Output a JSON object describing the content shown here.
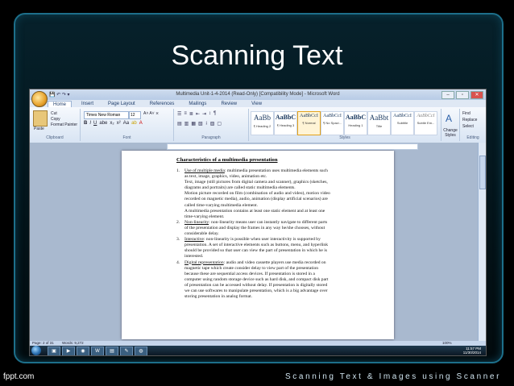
{
  "slide": {
    "title": "Scanning Text",
    "footer_left": "fppt.com",
    "footer_right": "Scanning Text & Images using Scanner"
  },
  "word": {
    "window_title": "Multimedia Unit-1-4-2014 (Read-Only) [Compatibility Mode] - Microsoft Word",
    "tabs": [
      "Home",
      "Insert",
      "Page Layout",
      "References",
      "Mailings",
      "Review",
      "View"
    ],
    "clipboard": {
      "paste": "Paste",
      "cut": "Cut",
      "copy": "Copy",
      "format_painter": "Format Painter",
      "label": "Clipboard"
    },
    "font": {
      "name": "Times New Roman",
      "size": "12",
      "label": "Font"
    },
    "paragraph_label": "Paragraph",
    "styles_label": "Styles",
    "styles": [
      {
        "sample": "AaBb",
        "name": "¶ Heading 2"
      },
      {
        "sample": "AaBbC",
        "name": "¶ Heading 3"
      },
      {
        "sample": "AaBbCcI",
        "name": "¶ Normal"
      },
      {
        "sample": "AaBbCcI",
        "name": "¶ No Spaci..."
      },
      {
        "sample": "AaBbC",
        "name": "Heading 1"
      },
      {
        "sample": "AaBbt",
        "name": "Title"
      },
      {
        "sample": "AaBbCcI",
        "name": "Subtitle"
      },
      {
        "sample": "AaBbCcI",
        "name": "Subtle Em..."
      }
    ],
    "change_styles": "Change Styles",
    "editing": {
      "find": "Find",
      "replace": "Replace",
      "select": "Select",
      "label": "Editing"
    },
    "status": {
      "page": "Page: 2 of 31",
      "words": "Words: 9,272",
      "zoom": "100%"
    },
    "clock": {
      "time": "11:57 PM",
      "date": "11/30/2014",
      "user": "MUKESH"
    }
  },
  "document": {
    "heading": "Characteristics of a multimedia presentation",
    "items": [
      {
        "num": "1.",
        "lead": "Use of multiple media",
        "lines": [
          ": multimedia presentation uses multimedia elements such",
          "as text, image, graphics, video, animation etc.",
          "Text, image (still pictures from digital camera and scanner), graphics (sketches,",
          "diagrams and portraits) are called static multimedia elements.",
          "Motion picture recorded on film (combination of audio and video), motion video",
          "recorded on magnetic media), audio, animation (display artificial scenarios) are",
          "called time-varying multimedia element.",
          "A multimedia presentation contains at least one static element and at least one",
          "time-varying element."
        ]
      },
      {
        "num": "2.",
        "lead": "Non-linearity",
        "lines": [
          ":  non-linearity means user can instantly navigate to different parts",
          "of the presentation and display the frames in any way he/she chooses, without",
          "considerable delay."
        ]
      },
      {
        "num": "3.",
        "lead": "Interactive",
        "lines": [
          ": non-linearity is possible  when user interactivity is supported by",
          "presentation.  A set of interactive elements such as buttons, menu, and hyperlink",
          "should be provided so that user can view the part of presentation in which he is",
          "interested."
        ]
      },
      {
        "num": "4.",
        "lead": "Digital representation",
        "lines": [
          ": audio and video cassette players use media recorded on",
          "magnetic tape which create consider delay to view part of the presentation",
          "because these are sequential access devices. If presentation is stored in a",
          "computer using random storage device such as hard disk, and compact disk part",
          "of presentation can be accessed without delay. If presentation is digitally stored",
          "we can use softwares to manipulate presentation, which is a big advantage over",
          "storing presentation in analog format."
        ]
      }
    ]
  }
}
